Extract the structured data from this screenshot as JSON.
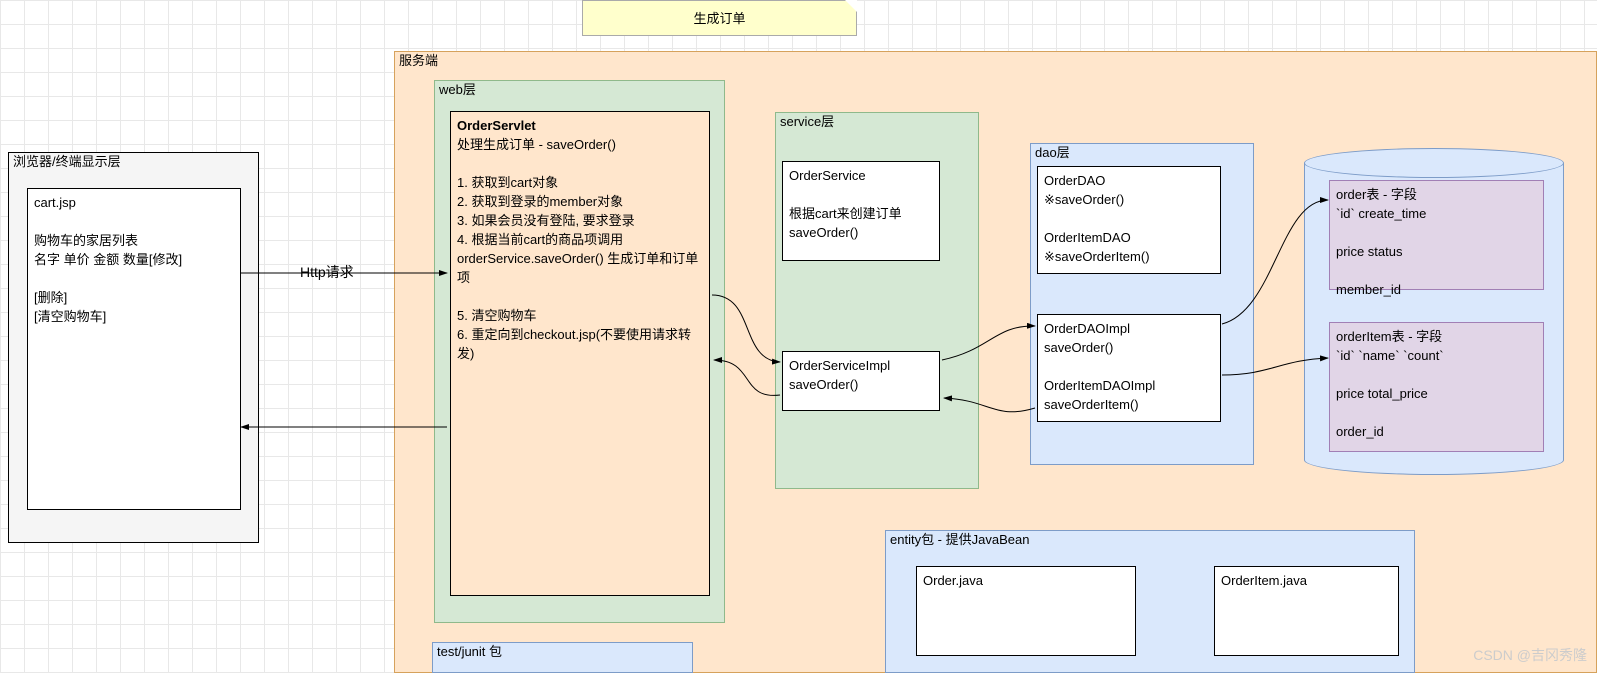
{
  "diagram": {
    "title": "生成订单",
    "http_label": "Http请求",
    "watermark": "CSDN @吉冈秀隆",
    "browser": {
      "layer_label": "浏览器/终端显示层",
      "card": {
        "file": "cart.jsp",
        "line1": "购物车的家居列表",
        "line2": "名字 单价 金额 数量[修改]",
        "line3": "[删除]",
        "line4": "[清空购物车]"
      }
    },
    "server": {
      "layer_label": "服务端",
      "web": {
        "layer_label": "web层",
        "servlet": {
          "name": "OrderServlet",
          "subtitle": "处理生成订单 - saveOrder()",
          "s1": "1. 获取到cart对象",
          "s2": "2. 获取到登录的member对象",
          "s3": "3. 如果会员没有登陆, 要求登录",
          "s4": "4. 根据当前cart的商品项调用orderService.saveOrder() 生成订单和订单项",
          "s5": "5. 清空购物车",
          "s6": "6. 重定向到checkout.jsp(不要使用请求转发)"
        }
      },
      "service": {
        "layer_label": "service层",
        "interface": {
          "name": "OrderService",
          "line1": "根据cart来创建订单saveOrder()"
        },
        "impl": {
          "name": "OrderServiceImpl",
          "method": "saveOrder()"
        }
      },
      "dao": {
        "layer_label": "dao层",
        "interface": {
          "l1": "OrderDAO",
          "l2": "※saveOrder()",
          "l3": "OrderItemDAO",
          "l4": "※saveOrderItem()"
        },
        "impl": {
          "l1": "OrderDAOImpl",
          "l2": "saveOrder()",
          "l3": "OrderItemDAOImpl",
          "l4": "saveOrderItem()"
        }
      },
      "entity": {
        "layer_label": "entity包 - 提供JavaBean",
        "box1": "Order.java",
        "box2": "OrderItem.java"
      },
      "test": {
        "layer_label": "test/junit 包"
      },
      "db": {
        "order_table": {
          "title": "order表 - 字段",
          "row1": "`id`    create_time",
          "row2": "price    status",
          "row3": "member_id"
        },
        "orderitem_table": {
          "title": "orderItem表 - 字段",
          "row1": "`id`    `name`    `count`",
          "row2": "price    total_price",
          "row3": "order_id"
        }
      }
    }
  }
}
